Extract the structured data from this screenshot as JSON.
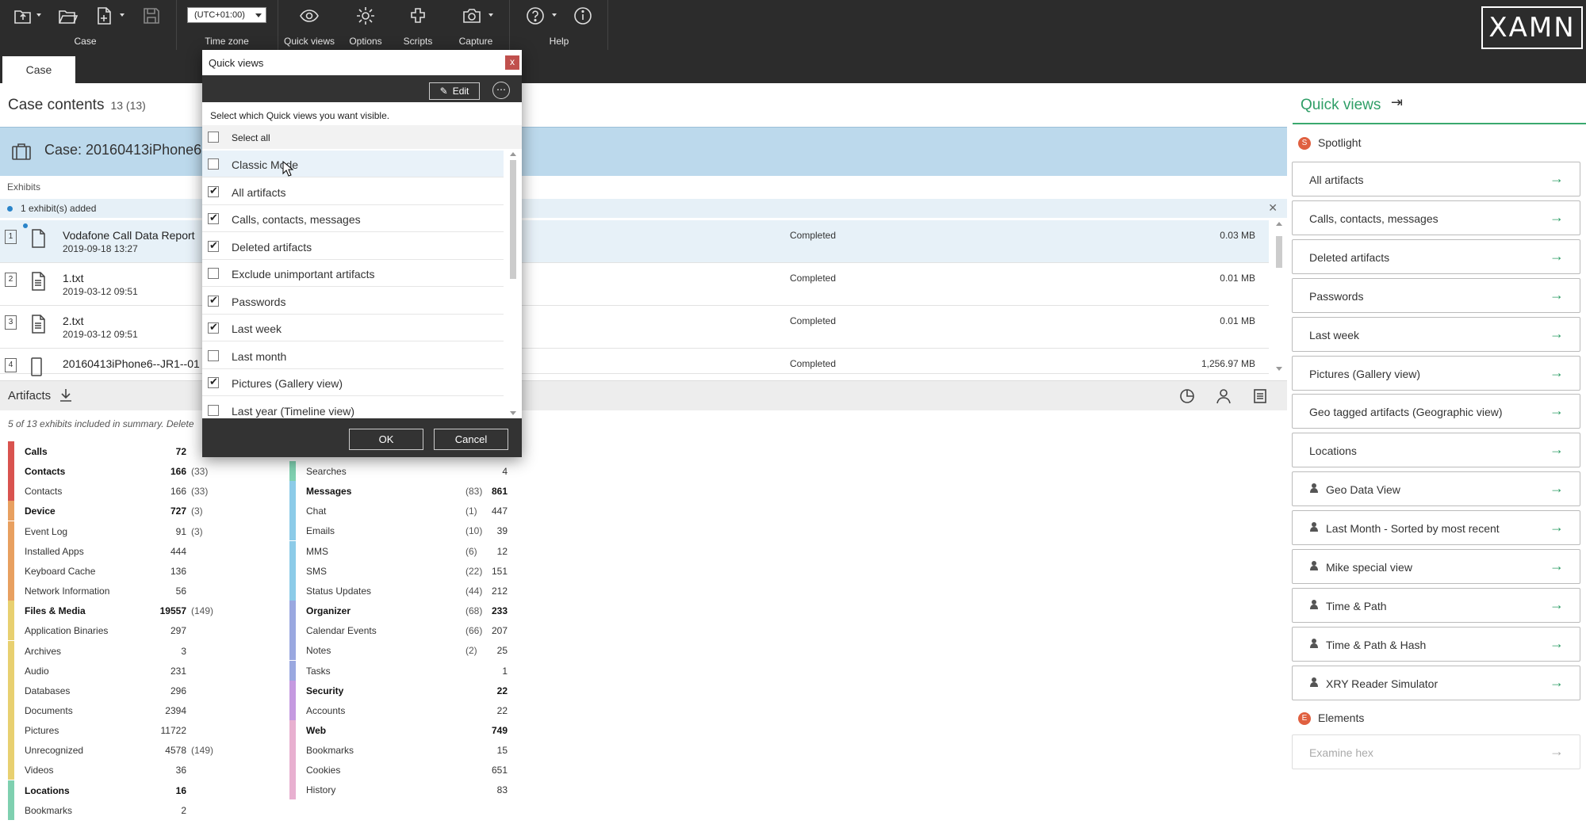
{
  "toolbar": {
    "groups": {
      "case": "Case",
      "timezone": "Time zone",
      "quick_views": "Quick views",
      "options": "Options",
      "scripts": "Scripts",
      "capture": "Capture",
      "help": "Help"
    },
    "timezone_value": "(UTC+01:00)",
    "logo": "XAMN"
  },
  "tabs": {
    "case": "Case"
  },
  "case_contents": {
    "title": "Case contents",
    "count": "13 (13)",
    "case_name": "Case: 20160413iPhone6"
  },
  "exhibits": {
    "label": "Exhibits",
    "info": "1 exhibit(s) added",
    "rows": [
      {
        "num": "1",
        "name": "Vodafone Call Data Report",
        "date": "2019-09-18 13:27",
        "status": "Completed",
        "size": "0.03 MB"
      },
      {
        "num": "2",
        "name": "1.txt",
        "date": "2019-03-12 09:51",
        "status": "Completed",
        "size": "0.01 MB"
      },
      {
        "num": "3",
        "name": "2.txt",
        "date": "2019-03-12 09:51",
        "status": "Completed",
        "size": "0.01 MB"
      },
      {
        "num": "4",
        "name": "20160413iPhone6--JR1--01",
        "date": "",
        "status": "Completed",
        "size": "1,256.97 MB"
      }
    ]
  },
  "artifacts": {
    "label": "Artifacts",
    "summary_note": "5 of 13 exhibits included in summary.   Delete",
    "col1": [
      {
        "name": "Calls",
        "val": "72",
        "paren": "",
        "bold": true,
        "color": "#d9534f"
      },
      {
        "name": "Contacts",
        "val": "166",
        "paren": "(33)",
        "bold": true,
        "color": "#d9534f"
      },
      {
        "name": "Contacts",
        "val": "166",
        "paren": "(33)",
        "bold": false,
        "color": "#d9534f"
      },
      {
        "name": "Device",
        "val": "727",
        "paren": "(3)",
        "bold": true,
        "color": "#e8a060"
      },
      {
        "name": "Event Log",
        "val": "91",
        "paren": "(3)",
        "bold": false,
        "color": "#e8a060"
      },
      {
        "name": "Installed Apps",
        "val": "444",
        "paren": "",
        "bold": false,
        "color": "#e8a060"
      },
      {
        "name": "Keyboard Cache",
        "val": "136",
        "paren": "",
        "bold": false,
        "color": "#e8a060"
      },
      {
        "name": "Network Information",
        "val": "56",
        "paren": "",
        "bold": false,
        "color": "#e8a060"
      },
      {
        "name": "Files & Media",
        "val": "19557",
        "paren": "(149)",
        "bold": true,
        "color": "#e8d070"
      },
      {
        "name": "Application Binaries",
        "val": "297",
        "paren": "",
        "bold": false,
        "color": "#e8d070"
      },
      {
        "name": "Archives",
        "val": "3",
        "paren": "",
        "bold": false,
        "color": "#e8d070"
      },
      {
        "name": "Audio",
        "val": "231",
        "paren": "",
        "bold": false,
        "color": "#e8d070"
      },
      {
        "name": "Databases",
        "val": "296",
        "paren": "",
        "bold": false,
        "color": "#e8d070"
      },
      {
        "name": "Documents",
        "val": "2394",
        "paren": "",
        "bold": false,
        "color": "#e8d070"
      },
      {
        "name": "Pictures",
        "val": "11722",
        "paren": "",
        "bold": false,
        "color": "#e8d070"
      },
      {
        "name": "Unrecognized",
        "val": "4578",
        "paren": "(149)",
        "bold": false,
        "color": "#e8d070"
      },
      {
        "name": "Videos",
        "val": "36",
        "paren": "",
        "bold": false,
        "color": "#e8d070"
      },
      {
        "name": "Locations",
        "val": "16",
        "paren": "",
        "bold": true,
        "color": "#7fd0b0"
      },
      {
        "name": "Bookmarks",
        "val": "2",
        "paren": "",
        "bold": false,
        "color": "#7fd0b0"
      }
    ],
    "col2": [
      {
        "name": "Searches",
        "val": "4",
        "paren": "",
        "bold": false,
        "color": "#7fd0b0"
      },
      {
        "name": "Messages",
        "val": "861",
        "paren": "(83)",
        "bold": true,
        "color": "#8ccbe8"
      },
      {
        "name": "Chat",
        "val": "447",
        "paren": "(1)",
        "bold": false,
        "color": "#8ccbe8"
      },
      {
        "name": "Emails",
        "val": "39",
        "paren": "(10)",
        "bold": false,
        "color": "#8ccbe8"
      },
      {
        "name": "MMS",
        "val": "12",
        "paren": "(6)",
        "bold": false,
        "color": "#8ccbe8"
      },
      {
        "name": "SMS",
        "val": "151",
        "paren": "(22)",
        "bold": false,
        "color": "#8ccbe8"
      },
      {
        "name": "Status Updates",
        "val": "212",
        "paren": "(44)",
        "bold": false,
        "color": "#8ccbe8"
      },
      {
        "name": "Organizer",
        "val": "233",
        "paren": "(68)",
        "bold": true,
        "color": "#9aa8e0"
      },
      {
        "name": "Calendar Events",
        "val": "207",
        "paren": "(66)",
        "bold": false,
        "color": "#9aa8e0"
      },
      {
        "name": "Notes",
        "val": "25",
        "paren": "(2)",
        "bold": false,
        "color": "#9aa8e0"
      },
      {
        "name": "Tasks",
        "val": "1",
        "paren": "",
        "bold": false,
        "color": "#9aa8e0"
      },
      {
        "name": "Security",
        "val": "22",
        "paren": "",
        "bold": true,
        "color": "#c59ae0"
      },
      {
        "name": "Accounts",
        "val": "22",
        "paren": "",
        "bold": false,
        "color": "#c59ae0"
      },
      {
        "name": "Web",
        "val": "749",
        "paren": "",
        "bold": true,
        "color": "#e8b0d0"
      },
      {
        "name": "Bookmarks",
        "val": "15",
        "paren": "",
        "bold": false,
        "color": "#e8b0d0"
      },
      {
        "name": "Cookies",
        "val": "651",
        "paren": "",
        "bold": false,
        "color": "#e8b0d0"
      },
      {
        "name": "History",
        "val": "83",
        "paren": "",
        "bold": false,
        "color": "#e8b0d0"
      }
    ]
  },
  "dialog": {
    "title": "Quick views",
    "close": "x",
    "edit": "Edit",
    "more": "⋯",
    "description": "Select which Quick views you want visible.",
    "select_all": "Select all",
    "items": [
      {
        "label": "Classic Mode",
        "checked": false
      },
      {
        "label": "All artifacts",
        "checked": true
      },
      {
        "label": "Calls, contacts, messages",
        "checked": true
      },
      {
        "label": "Deleted artifacts",
        "checked": true
      },
      {
        "label": "Exclude unimportant artifacts",
        "checked": false
      },
      {
        "label": "Passwords",
        "checked": true
      },
      {
        "label": "Last week",
        "checked": true
      },
      {
        "label": "Last month",
        "checked": false
      },
      {
        "label": "Pictures (Gallery view)",
        "checked": true
      },
      {
        "label": "Last year (Timeline view)",
        "checked": false
      }
    ],
    "ok": "OK",
    "cancel": "Cancel"
  },
  "right_panel": {
    "title": "Quick views",
    "spotlight": "Spotlight",
    "spotlight_badge": "S",
    "elements": "Elements",
    "elements_badge": "E",
    "cards": [
      {
        "label": "All artifacts",
        "user": false
      },
      {
        "label": "Calls, contacts, messages",
        "user": false
      },
      {
        "label": "Deleted artifacts",
        "user": false
      },
      {
        "label": "Passwords",
        "user": false
      },
      {
        "label": "Last week",
        "user": false
      },
      {
        "label": "Pictures (Gallery view)",
        "user": false
      },
      {
        "label": "Geo tagged artifacts (Geographic view)",
        "user": false
      },
      {
        "label": "Locations",
        "user": false
      },
      {
        "label": "Geo Data View",
        "user": true
      },
      {
        "label": "Last Month - Sorted by most recent",
        "user": true
      },
      {
        "label": "Mike special view",
        "user": true
      },
      {
        "label": "Time & Path",
        "user": true
      },
      {
        "label": "Time & Path & Hash",
        "user": true
      },
      {
        "label": "XRY Reader Simulator",
        "user": true
      }
    ],
    "examine_hex": "Examine hex"
  }
}
